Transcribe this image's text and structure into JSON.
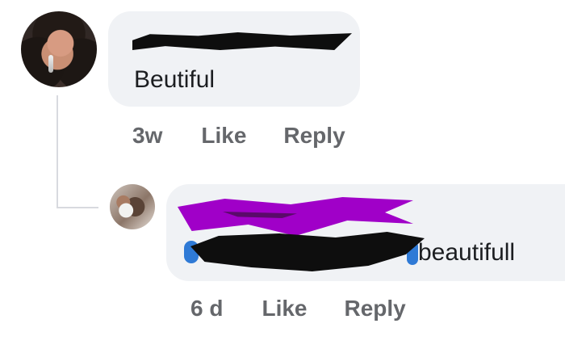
{
  "comments": [
    {
      "text": "Beutiful",
      "time": "3w",
      "like_label": "Like",
      "reply_label": "Reply"
    },
    {
      "text": "beautifull",
      "time": "6 d",
      "like_label": "Like",
      "reply_label": "Reply"
    }
  ],
  "colors": {
    "bubble": "#f0f2f5",
    "meta_text": "#65676b",
    "thread_line": "#d8dadf",
    "mention_blue": "#2f7ad6",
    "scribble_purple": "#a000c8",
    "redaction_black": "#0e0e0e"
  }
}
